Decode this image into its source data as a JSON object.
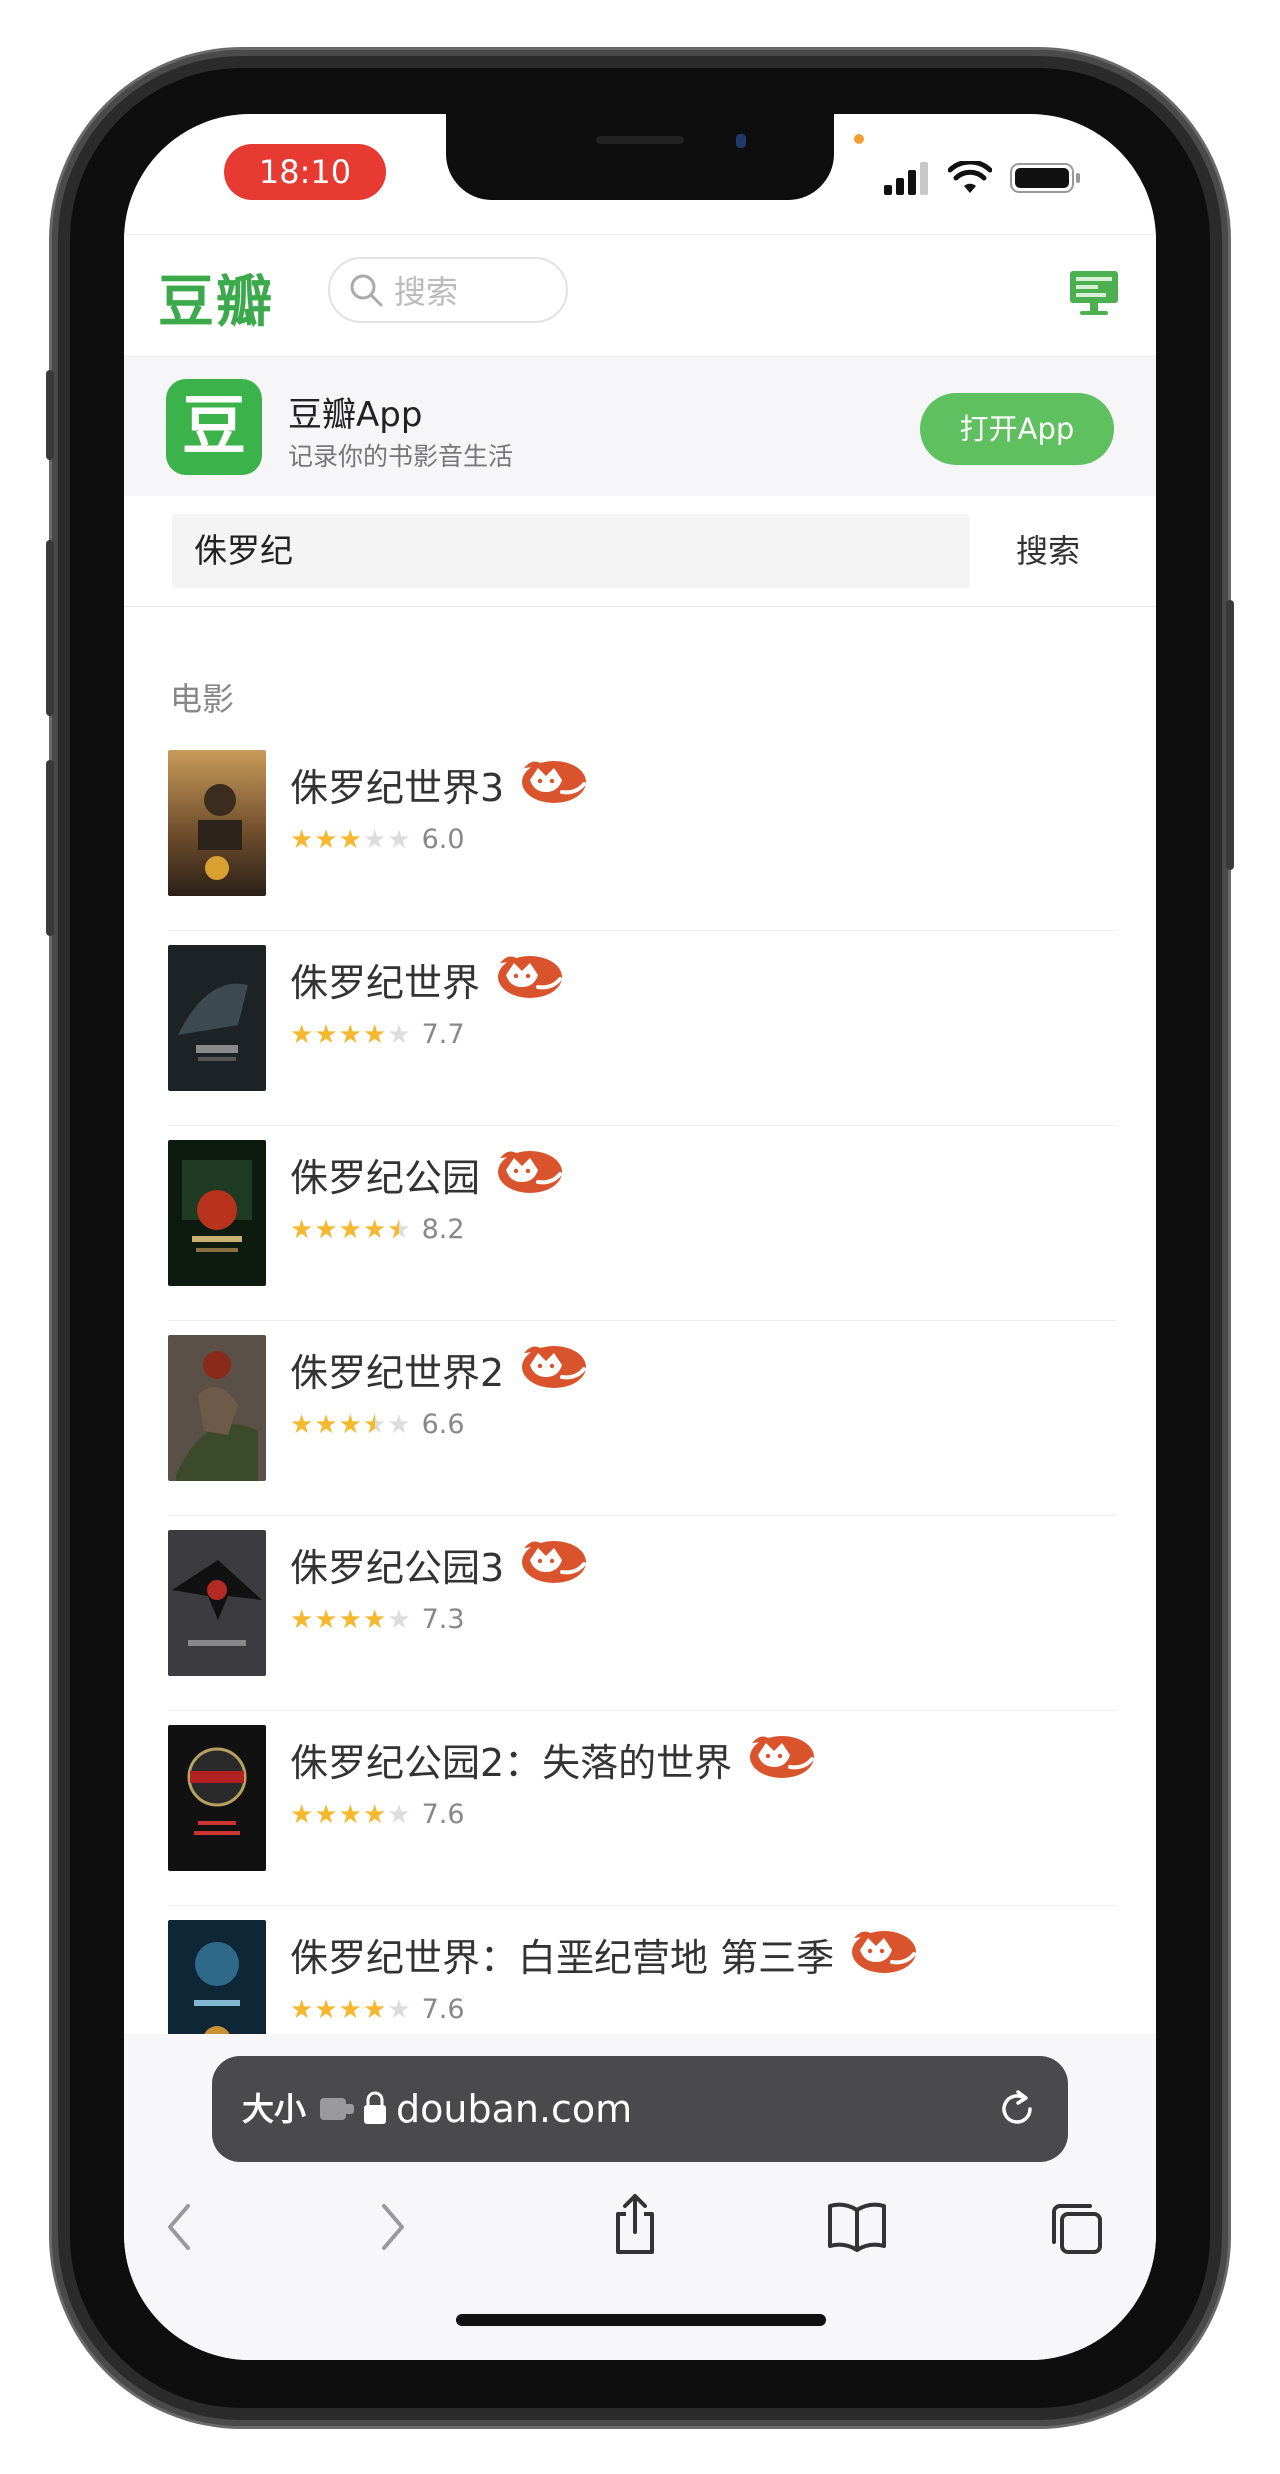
{
  "status_bar": {
    "time": "18:10"
  },
  "header": {
    "logo": "豆瓣",
    "search_placeholder": "搜索",
    "icons": [
      "search-icon",
      "desktop-version-icon"
    ]
  },
  "app_banner": {
    "icon_char": "豆",
    "name": "豆瓣App",
    "description": "记录你的书影音生活",
    "open_button": "打开App"
  },
  "search": {
    "query": "侏罗纪",
    "button": "搜索"
  },
  "section": {
    "title": "电影"
  },
  "results": [
    {
      "title": "侏罗纪世界3",
      "stars_full": 3,
      "stars_half": 0,
      "score": "6.0"
    },
    {
      "title": "侏罗纪世界",
      "stars_full": 4,
      "stars_half": 0,
      "score": "7.7"
    },
    {
      "title": "侏罗纪公园",
      "stars_full": 4,
      "stars_half": 1,
      "score": "8.2"
    },
    {
      "title": "侏罗纪世界2",
      "stars_full": 3,
      "stars_half": 1,
      "score": "6.6"
    },
    {
      "title": "侏罗纪公园3",
      "stars_full": 4,
      "stars_half": 0,
      "score": "7.3"
    },
    {
      "title": "侏罗纪公园2：失落的世界",
      "stars_full": 4,
      "stars_half": 0,
      "score": "7.6"
    },
    {
      "title": "侏罗纪世界：白垩纪营地 第三季",
      "stars_full": 4,
      "stars_half": 0,
      "score": "7.6"
    }
  ],
  "browser": {
    "text_size_label": "大小",
    "url": "douban.com",
    "toolbar_icons": [
      "back-icon",
      "forward-icon",
      "share-icon",
      "bookmarks-icon",
      "tabs-icon"
    ]
  },
  "colors": {
    "brand_green": "#3ba94c",
    "star": "#f5b82e",
    "star_empty": "#dddddd",
    "time_pill": "#e63a33",
    "fox": "#d9532c"
  }
}
